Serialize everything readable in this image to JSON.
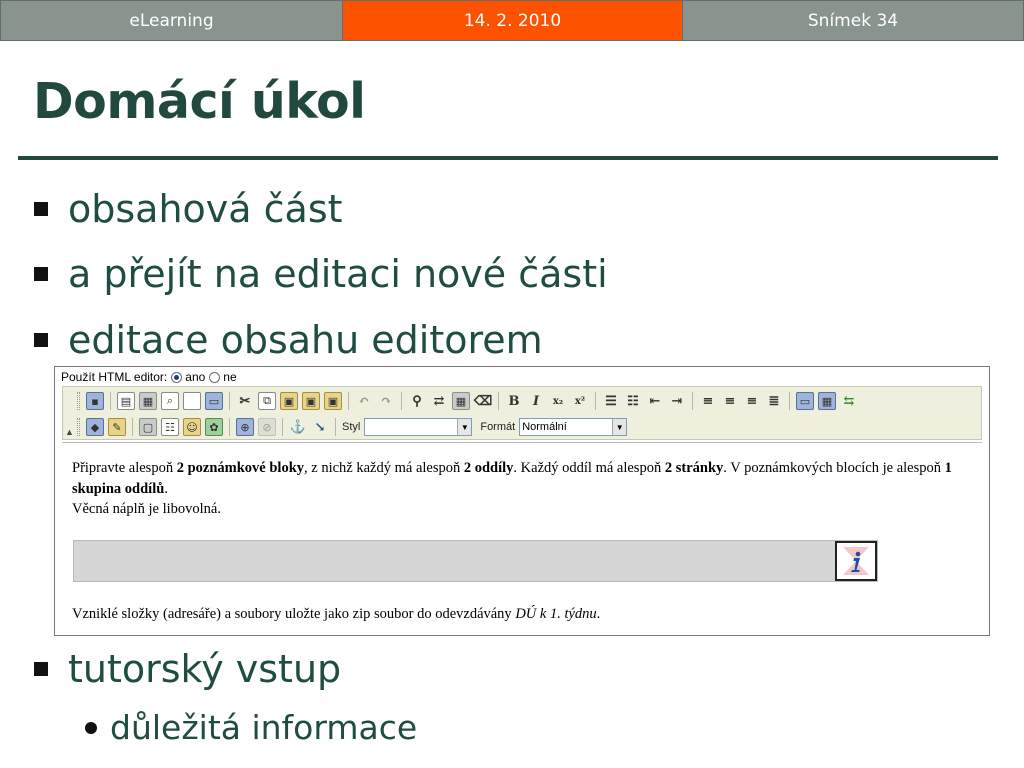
{
  "header": {
    "left": "eLearning",
    "date": "14. 2. 2010",
    "slide": "Snímek 34"
  },
  "colors": {
    "header_grey": "#8a948f",
    "header_accent": "#fd5200",
    "title_green": "#21493f",
    "text_green": "#1f4d43"
  },
  "title": "Domácí úkol",
  "bullets": [
    "obsahová část",
    "a přejít na editaci nové části",
    "editace obsahu editorem",
    "tutorský vstup"
  ],
  "sub_bullets": [
    "důležitá informace"
  ],
  "editor": {
    "use_html_label": "Použít HTML editor:",
    "option_yes": "ano",
    "option_no": "ne",
    "selected_option": "ano",
    "style_label": "Styl",
    "style_value": "",
    "format_label": "Formát",
    "format_value": "Normální",
    "content": {
      "p1_a": "Připravte alespoň ",
      "p1_b": "2 poznámkové bloky",
      "p1_c": ", z nichž každý má alespoň ",
      "p1_d": "2 oddíly",
      "p1_e": ". Každý oddíl má alespoň ",
      "p1_f": "2 stránky",
      "p1_g": ". V poznámkových blocích je alespoň ",
      "p1_h": "1 skupina oddílů",
      "p1_i": ".",
      "p2": "Věcná náplň je libovolná.",
      "last_a": "Vzniklé složky (adresáře) a soubory uložte jako zip soubor do odevzdávány ",
      "last_b": "DÚ k 1. týdnu",
      "last_c": "."
    },
    "toolbar_row1": [
      "save-icon",
      "preview-icon",
      "template-icon",
      "print-preview-icon",
      "new-page-icon",
      "source-icon",
      "cut-icon",
      "copy-icon",
      "paste-icon",
      "paste-text-icon",
      "paste-word-icon",
      "undo-icon",
      "redo-icon",
      "find-icon",
      "replace-icon",
      "select-all-icon",
      "eraser-icon",
      "bold-icon",
      "italic-icon",
      "subscript-icon",
      "superscript-icon",
      "ordered-list-icon",
      "unordered-list-icon",
      "outdent-icon",
      "indent-icon",
      "align-left-icon",
      "align-center-icon",
      "align-right-icon",
      "justify-icon",
      "image-icon",
      "table-icon",
      "rule-icon"
    ],
    "toolbar_row2": [
      "cube-icon",
      "pencil-icon",
      "tag-icon",
      "form-icon",
      "smiley-icon",
      "puzzle-icon",
      "link-icon",
      "unlink-icon",
      "anchor-icon",
      "anchor-link-icon"
    ]
  }
}
